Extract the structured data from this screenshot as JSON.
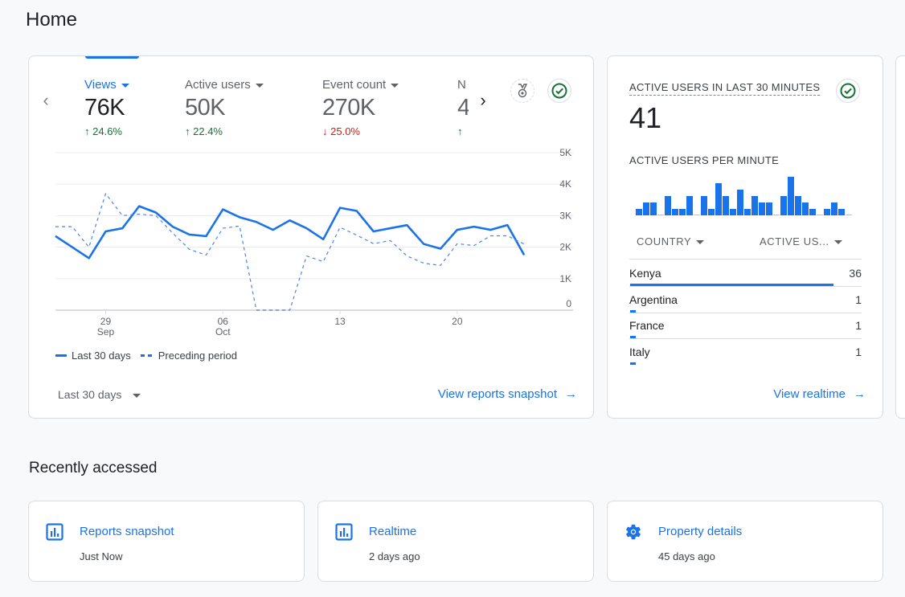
{
  "page": {
    "title": "Home"
  },
  "overview": {
    "metrics": [
      {
        "label": "Views",
        "value": "76K",
        "delta": "24.6%",
        "direction": "up",
        "active": true
      },
      {
        "label": "Active users",
        "value": "50K",
        "delta": "22.4%",
        "direction": "up",
        "active": false
      },
      {
        "label": "Event count",
        "value": "270K",
        "delta": "25.0%",
        "direction": "down",
        "active": false
      },
      {
        "label": "N",
        "value": "4",
        "delta": "",
        "direction": "up",
        "active": false
      }
    ],
    "icons": {
      "prev": "chevron-left-icon",
      "next": "chevron-right-icon",
      "badge": "medal-icon",
      "status": "check-circle-icon"
    },
    "legend": {
      "current": "Last 30 days",
      "previous": "Preceding period"
    },
    "date_range": "Last 30 days",
    "link": "View reports snapshot",
    "colors": {
      "accent": "#1a73e8",
      "up": "#137333",
      "down": "#c5221f"
    }
  },
  "chart_data": {
    "type": "line",
    "title": "Views",
    "ylabel": "",
    "xlabel": "",
    "ylim": [
      0,
      5000
    ],
    "y_ticks": [
      "0",
      "1K",
      "2K",
      "3K",
      "4K",
      "5K"
    ],
    "y_tick_values": [
      0,
      1000,
      2000,
      3000,
      4000,
      5000
    ],
    "x_ticks": [
      {
        "index": 3,
        "label": "29",
        "sub": "Sep"
      },
      {
        "index": 10,
        "label": "06",
        "sub": "Oct"
      },
      {
        "index": 17,
        "label": "13",
        "sub": ""
      },
      {
        "index": 24,
        "label": "20",
        "sub": ""
      }
    ],
    "grid": true,
    "legend_position": "bottom-left",
    "x": [
      0,
      1,
      2,
      3,
      4,
      5,
      6,
      7,
      8,
      9,
      10,
      11,
      12,
      13,
      14,
      15,
      16,
      17,
      18,
      19,
      20,
      21,
      22,
      23,
      24,
      25,
      26,
      27,
      28,
      29
    ],
    "series": [
      {
        "name": "Last 30 days",
        "style": "solid",
        "values": [
          2350,
          2000,
          1650,
          2500,
          2600,
          3300,
          3100,
          2650,
          2400,
          2350,
          3200,
          2950,
          2800,
          2550,
          2850,
          2600,
          2250,
          3250,
          3150,
          2500,
          2600,
          2700,
          2100,
          1950,
          2550,
          2650,
          2550,
          2700,
          1750
        ]
      },
      {
        "name": "Preceding period",
        "style": "dashed",
        "values": [
          2650,
          2650,
          2000,
          3700,
          3000,
          3050,
          3000,
          2450,
          1930,
          1750,
          2600,
          2670,
          0,
          0,
          0,
          1720,
          1540,
          2630,
          2380,
          2110,
          2210,
          1720,
          1490,
          1420,
          2110,
          2050,
          2360,
          2360,
          2100
        ]
      }
    ]
  },
  "realtime": {
    "title": "ACTIVE USERS IN LAST 30 MINUTES",
    "value": "41",
    "subtitle": "ACTIVE USERS PER MINUTE",
    "per_minute": [
      1,
      2,
      2,
      0,
      3,
      1,
      1,
      3,
      0,
      3,
      1,
      5,
      3,
      1,
      4,
      1,
      3,
      2,
      2,
      0,
      3,
      6,
      3,
      2,
      1,
      0,
      1,
      2,
      1,
      0
    ],
    "columns": {
      "country": "COUNTRY",
      "users": "ACTIVE US..."
    },
    "rows": [
      {
        "country": "Kenya",
        "users": 36
      },
      {
        "country": "Argentina",
        "users": 1
      },
      {
        "country": "France",
        "users": 1
      },
      {
        "country": "Italy",
        "users": 1
      }
    ],
    "link": "View realtime"
  },
  "recent": {
    "title": "Recently accessed",
    "items": [
      {
        "title": "Reports snapshot",
        "subtitle": "Just Now",
        "icon": "bar-chart-icon"
      },
      {
        "title": "Realtime",
        "subtitle": "2 days ago",
        "icon": "bar-chart-icon"
      },
      {
        "title": "Property details",
        "subtitle": "45 days ago",
        "icon": "gear-icon"
      }
    ]
  }
}
